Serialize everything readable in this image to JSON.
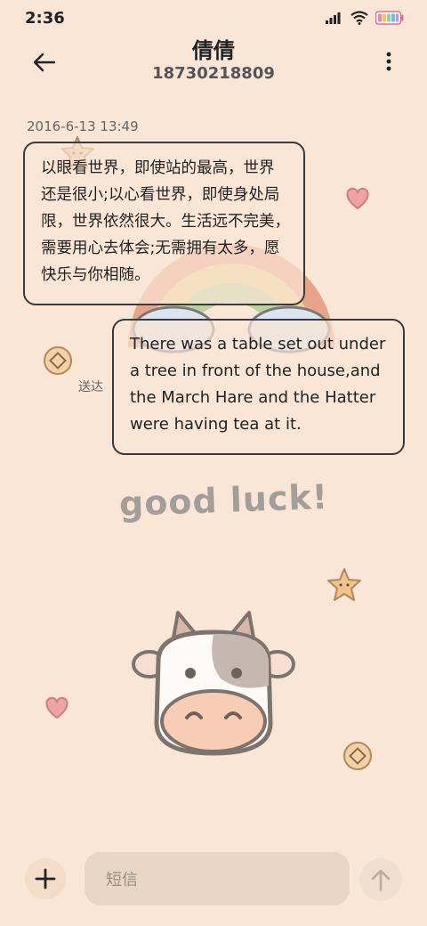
{
  "status_bar": {
    "time": "2:36",
    "icons": [
      "signal-icon",
      "wifi-icon",
      "battery-icon"
    ]
  },
  "header": {
    "title": "倩倩",
    "subtitle": "18730218809",
    "back_icon": "arrow-left-icon",
    "more_icon": "more-vertical-icon"
  },
  "conversation": {
    "timestamp": "2016-6-13 13:49",
    "messages": [
      {
        "direction": "incoming",
        "lines": [
          "以眼看世界，即使站的最高，世界",
          "还是很小;以心看世界，即使身处局",
          "限，世界依然很大。生活远不完美，",
          "需要用心去体会;无需拥有太多，愿",
          "快乐与你相随。"
        ]
      },
      {
        "direction": "outgoing",
        "lines": [
          "There was a table set out under",
          "a tree in front of the house,and",
          "the March Hare and the Hatter",
          "were having tea at it."
        ],
        "status": "送达"
      }
    ]
  },
  "decor": {
    "good_luck": "good luck!"
  },
  "composer": {
    "placeholder": "短信",
    "add_icon": "plus-icon",
    "send_icon": "arrow-up-icon"
  },
  "colors": {
    "background": "#f9e6d6",
    "bubble_border": "#3b3b3b",
    "input_bg": "#ead6c4"
  }
}
